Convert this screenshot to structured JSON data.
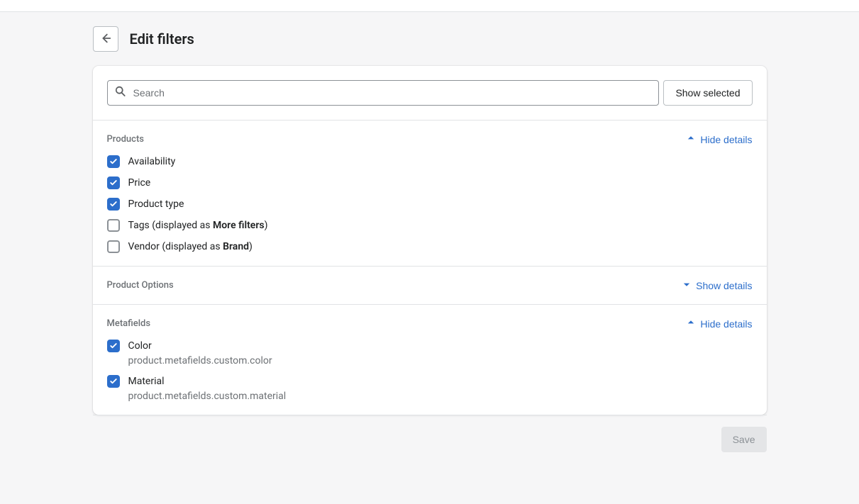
{
  "header": {
    "title": "Edit filters"
  },
  "search": {
    "placeholder": "Search",
    "show_selected_label": "Show selected"
  },
  "sections": {
    "products": {
      "title": "Products",
      "toggle_label": "Hide details",
      "items": [
        {
          "label_pre": "Availability",
          "label_strong": "",
          "label_post": "",
          "checked": true
        },
        {
          "label_pre": "Price",
          "label_strong": "",
          "label_post": "",
          "checked": true
        },
        {
          "label_pre": "Product type",
          "label_strong": "",
          "label_post": "",
          "checked": true
        },
        {
          "label_pre": "Tags (displayed as ",
          "label_strong": "More filters",
          "label_post": ")",
          "checked": false
        },
        {
          "label_pre": "Vendor (displayed as ",
          "label_strong": "Brand",
          "label_post": ")",
          "checked": false
        }
      ]
    },
    "product_options": {
      "title": "Product Options",
      "toggle_label": "Show details"
    },
    "metafields": {
      "title": "Metafields",
      "toggle_label": "Hide details",
      "items": [
        {
          "label": "Color",
          "sub": "product.metafields.custom.color",
          "checked": true
        },
        {
          "label": "Material",
          "sub": "product.metafields.custom.material",
          "checked": true
        }
      ]
    }
  },
  "footer": {
    "save_label": "Save"
  }
}
